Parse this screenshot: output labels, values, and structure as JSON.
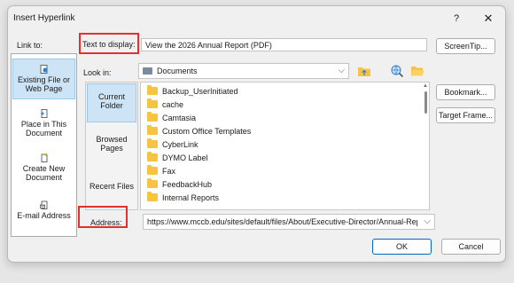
{
  "window": {
    "title": "Insert Hyperlink",
    "help_glyph": "?",
    "close_glyph": "✕"
  },
  "link_to": {
    "label": "Link to:",
    "items": [
      {
        "label": "Existing File or Web Page",
        "icon": "web-page-icon",
        "selected": true
      },
      {
        "label": "Place in This Document",
        "icon": "document-place-icon",
        "selected": false
      },
      {
        "label": "Create New Document",
        "icon": "new-document-icon",
        "selected": false
      },
      {
        "label": "E-mail Address",
        "icon": "email-icon",
        "selected": false
      }
    ]
  },
  "text_to_display": {
    "label": "Text to display:",
    "value": "View the 2026 Annual Report (PDF)"
  },
  "buttons": {
    "screentip": "ScreenTip...",
    "bookmark": "Bookmark...",
    "target_frame": "Target Frame...",
    "ok": "OK",
    "cancel": "Cancel"
  },
  "look_in": {
    "label": "Look in:",
    "value": "Documents",
    "chevron": "⌵"
  },
  "nav": {
    "items": [
      {
        "label": "Current Folder",
        "selected": true
      },
      {
        "label": "Browsed Pages",
        "selected": false
      },
      {
        "label": "Recent Files",
        "selected": false
      }
    ]
  },
  "files": [
    "Backup_UserInitiated",
    "cache",
    "Camtasia",
    "Custom Office Templates",
    "CyberLink",
    "DYMO Label",
    "Fax",
    "FeedbackHub",
    "Internal Reports"
  ],
  "address": {
    "label": "Address:",
    "value": "https://www.mccb.edu/sites/default/files/About/Executive-Director/Annual-Repo",
    "chevron": "⌵"
  },
  "colors": {
    "highlight": "#e03131",
    "selection": "#cde4f7",
    "folder": "#f6c343",
    "primary_border": "#0067c0"
  }
}
